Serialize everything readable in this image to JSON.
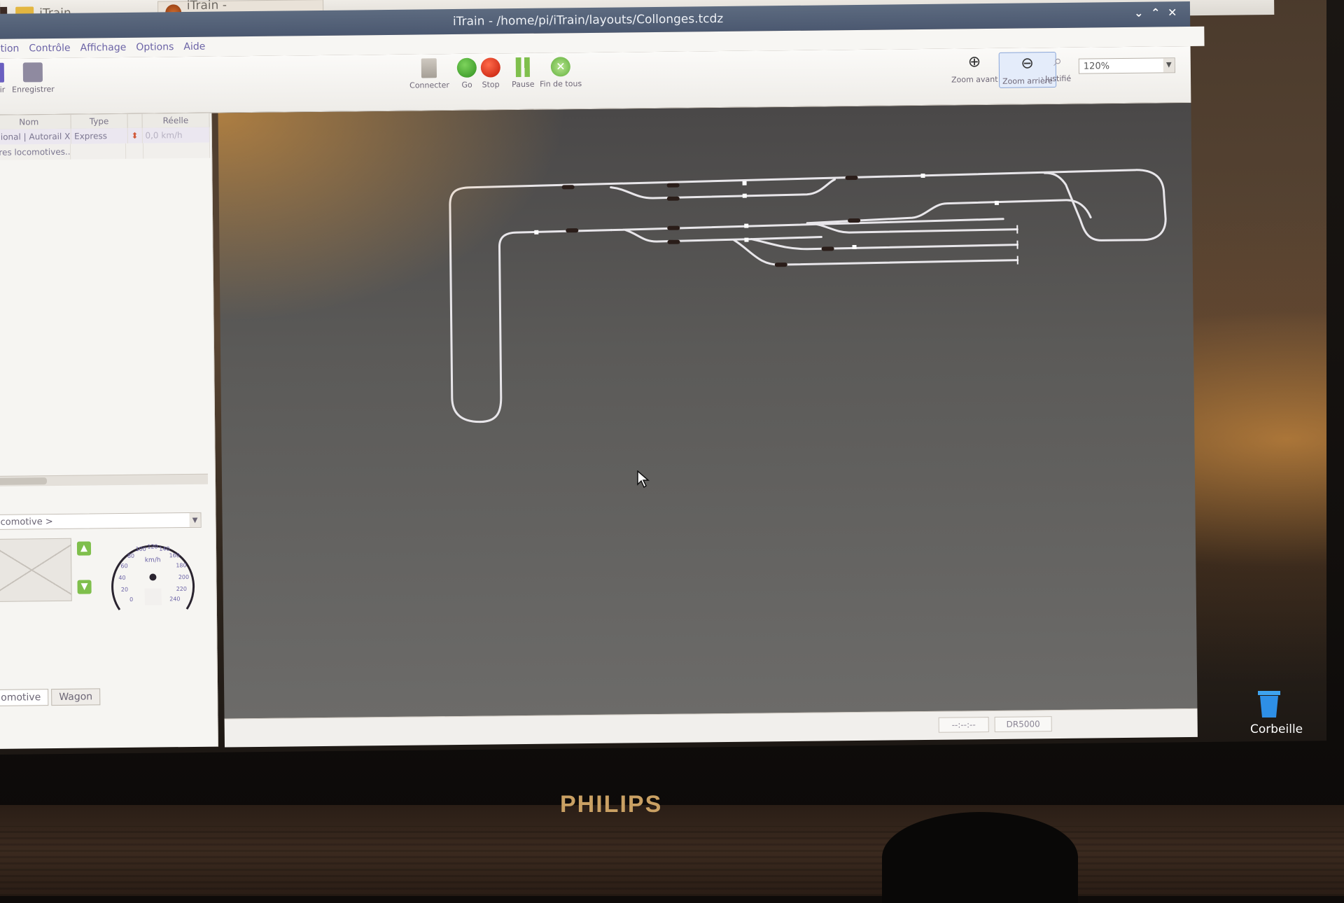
{
  "taskbar": {
    "items": [
      {
        "label": "iTrain",
        "icon": "folder-icon"
      },
      {
        "label": "iTrain - /home/pi/iTrai...",
        "icon": "app-icon"
      }
    ]
  },
  "window": {
    "title": "iTrain - /home/pi/iTrain/layouts/Collonges.tcdz",
    "controls": [
      "⌄",
      "⌃",
      "✕"
    ]
  },
  "menu": [
    "tion",
    "Contrôle",
    "Affichage",
    "Options",
    "Aide"
  ],
  "toolbar": {
    "open_label": "rir",
    "save_label": "Enregistrer",
    "connect_label": "Connecter",
    "go_label": "Go",
    "stop_label": "Stop",
    "pause_label": "Pause",
    "all_label": "Fin de tous",
    "zoom_in_label": "Zoom avant",
    "zoom_out_label": "Zoom arrière",
    "fit_label": "Justifié",
    "zoom_value": "120%"
  },
  "loco_table": {
    "headers": [
      "Nom",
      "Type",
      "",
      "Réelle"
    ],
    "rows": [
      {
        "name": "égional | Autorail X...",
        "type": "Express",
        "speed": "0,0 km/h"
      },
      {
        "name": "utres locomotives...",
        "type": "",
        "speed": ""
      }
    ]
  },
  "control": {
    "loco_select": "ocomotive >",
    "gauge_unit": "km/h",
    "gauge_ticks": [
      "0",
      "20",
      "40",
      "60",
      "80",
      "100",
      "120",
      "140",
      "160",
      "180",
      "200",
      "220",
      "240"
    ]
  },
  "tabs": [
    "omotive",
    "Wagon"
  ],
  "status": {
    "clock": "--:--:--",
    "device": "DR5000"
  },
  "desktop": {
    "trash_label": "Corbeille",
    "brand": "PHILIPS"
  },
  "colors": {
    "titlebar": "#4b5870",
    "track": "#e8e6ea",
    "go": "#2f8f1f",
    "stop": "#c21b08"
  }
}
